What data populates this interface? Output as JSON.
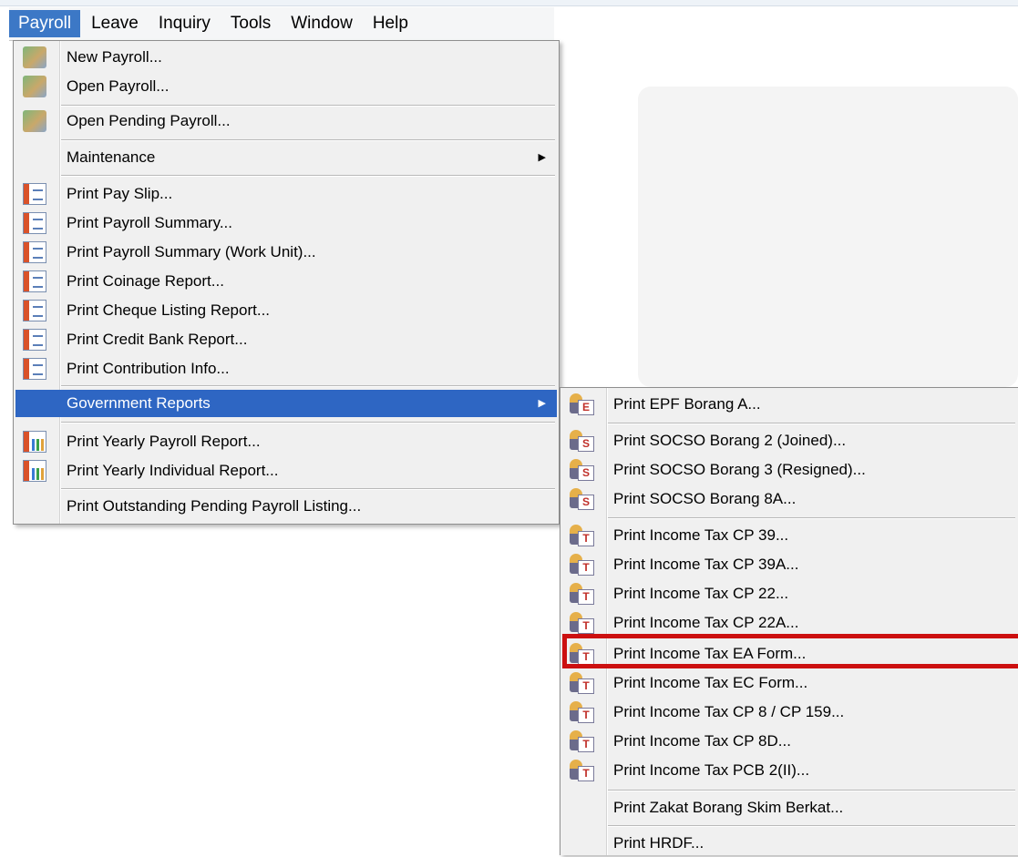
{
  "menubar": {
    "items": [
      "Payroll",
      "Leave",
      "Inquiry",
      "Tools",
      "Window",
      "Help"
    ],
    "active_index": 0
  },
  "payroll_menu": {
    "new_payroll": "New Payroll...",
    "open_payroll": "Open Payroll...",
    "open_pending_payroll": "Open Pending Payroll...",
    "maintenance": "Maintenance",
    "print_pay_slip": "Print Pay Slip...",
    "print_payroll_summary": "Print Payroll Summary...",
    "print_payroll_summary_work_unit": "Print Payroll Summary (Work Unit)...",
    "print_coinage_report": "Print Coinage Report...",
    "print_cheque_listing_report": "Print Cheque Listing Report...",
    "print_credit_bank_report": "Print Credit Bank Report...",
    "print_contribution_info": "Print Contribution Info...",
    "government_reports": "Government Reports",
    "print_yearly_payroll_report": "Print Yearly Payroll Report...",
    "print_yearly_individual_report": "Print Yearly Individual Report...",
    "print_outstanding_pending_payroll_listing": "Print Outstanding Pending Payroll Listing..."
  },
  "government_submenu": {
    "epf_borang_a": "Print EPF Borang A...",
    "socso_borang_2": "Print SOCSO Borang 2 (Joined)...",
    "socso_borang_3": "Print SOCSO Borang 3 (Resigned)...",
    "socso_borang_8a": "Print SOCSO Borang 8A...",
    "tax_cp39": "Print Income Tax CP 39...",
    "tax_cp39a": "Print Income Tax CP 39A...",
    "tax_cp22": "Print Income Tax CP 22...",
    "tax_cp22a": "Print Income Tax CP 22A...",
    "tax_ea_form": "Print Income Tax EA Form...",
    "tax_ec_form": "Print Income Tax EC Form...",
    "tax_cp8_cp159": "Print Income Tax CP 8 / CP 159...",
    "tax_cp8d": "Print Income Tax CP 8D...",
    "tax_pcb2": "Print Income Tax PCB 2(II)...",
    "zakat_borang": "Print Zakat Borang Skim Berkat...",
    "hrdf": "Print HRDF..."
  },
  "icon_letters": {
    "epf": "E",
    "socso": "S",
    "tax": "T"
  },
  "colors": {
    "highlight": "#2e66c3",
    "menubar_active": "#3c78c6",
    "annotation_box": "#cc1010"
  }
}
